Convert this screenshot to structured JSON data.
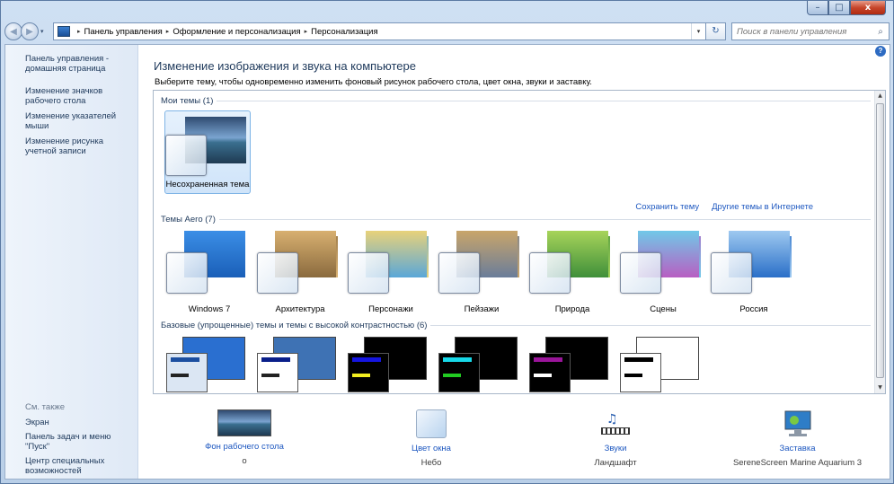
{
  "window": {
    "minimize": "–",
    "maximize": "□",
    "close": "x"
  },
  "nav": {
    "back": "◀",
    "forward": "▶",
    "history": "▾",
    "crumbs": [
      "Панель управления",
      "Оформление и персонализация",
      "Персонализация"
    ],
    "crumb_sep": "▸",
    "address_drop": "▾",
    "refresh": "↻",
    "search_placeholder": "Поиск в панели управления",
    "search_icon": "search-icon"
  },
  "help": "?",
  "sidebar": {
    "home": "Панель управления - домашняя страница",
    "links": [
      "Изменение значков рабочего стола",
      "Изменение указателей мыши",
      "Изменение рисунка учетной записи"
    ],
    "see_also_header": "См. также",
    "see_also": [
      "Экран",
      "Панель задач и меню \"Пуск\"",
      "Центр специальных возможностей"
    ]
  },
  "main": {
    "title": "Изменение изображения и звука на компьютере",
    "description": "Выберите тему, чтобы одновременно изменить фоновый рисунок рабочего стола, цвет окна, звуки и заставку."
  },
  "groups": {
    "my_themes": "Мои темы (1)",
    "aero": "Темы Aero (7)",
    "basic": "Базовые (упрощенные) темы и темы с высокой контрастностью (6)"
  },
  "my_themes": [
    {
      "label": "Несохраненная тема",
      "selected": true
    }
  ],
  "links": {
    "save": "Сохранить тему",
    "online": "Другие темы в Интернете"
  },
  "aero_themes": [
    {
      "label": "Windows 7",
      "colors": [
        "#1a5fb8",
        "#3b8ee6"
      ]
    },
    {
      "label": "Архитектура",
      "colors": [
        "#8a6a3e",
        "#d8b070"
      ]
    },
    {
      "label": "Персонажи",
      "colors": [
        "#5aa7d8",
        "#e8d27a"
      ]
    },
    {
      "label": "Пейзажи",
      "colors": [
        "#6a7d9a",
        "#c9a56a"
      ]
    },
    {
      "label": "Природа",
      "colors": [
        "#3f8f3a",
        "#a7d45a"
      ]
    },
    {
      "label": "Сцены",
      "colors": [
        "#b85fc2",
        "#70c8e8"
      ]
    },
    {
      "label": "Россия",
      "colors": [
        "#2a6fc8",
        "#9ec9f0"
      ]
    }
  ],
  "basic_themes": [
    {
      "bg": "#2a6fd0",
      "win": "#dbe6f3",
      "bar1": "#1c4fa0",
      "bar2": "#222"
    },
    {
      "bg": "#3e72b4",
      "win": "#ffffff",
      "bar1": "#0a1f8a",
      "bar2": "#222"
    },
    {
      "bg": "#000000",
      "win": "#000000",
      "bar1": "#1515e0",
      "bar2": "#f2ee20"
    },
    {
      "bg": "#000000",
      "win": "#000000",
      "bar1": "#17d8e8",
      "bar2": "#22cc22"
    },
    {
      "bg": "#000000",
      "win": "#000000",
      "bar1": "#9a159a",
      "bar2": "#ffffff"
    },
    {
      "bg": "#ffffff",
      "win": "#ffffff",
      "bar1": "#000000",
      "bar2": "#000000"
    }
  ],
  "bottom": [
    {
      "caption": "Фон рабочего стола",
      "sub": "o",
      "icon": "wallpaper-icon"
    },
    {
      "caption": "Цвет окна",
      "sub": "Небо",
      "icon": "window-color-icon"
    },
    {
      "caption": "Звуки",
      "sub": "Ландшафт",
      "icon": "sounds-icon"
    },
    {
      "caption": "Заставка",
      "sub": "SereneScreen Marine Aquarium 3",
      "icon": "screensaver-icon"
    }
  ],
  "scrollbar": {
    "up": "▲",
    "down": "▼"
  }
}
